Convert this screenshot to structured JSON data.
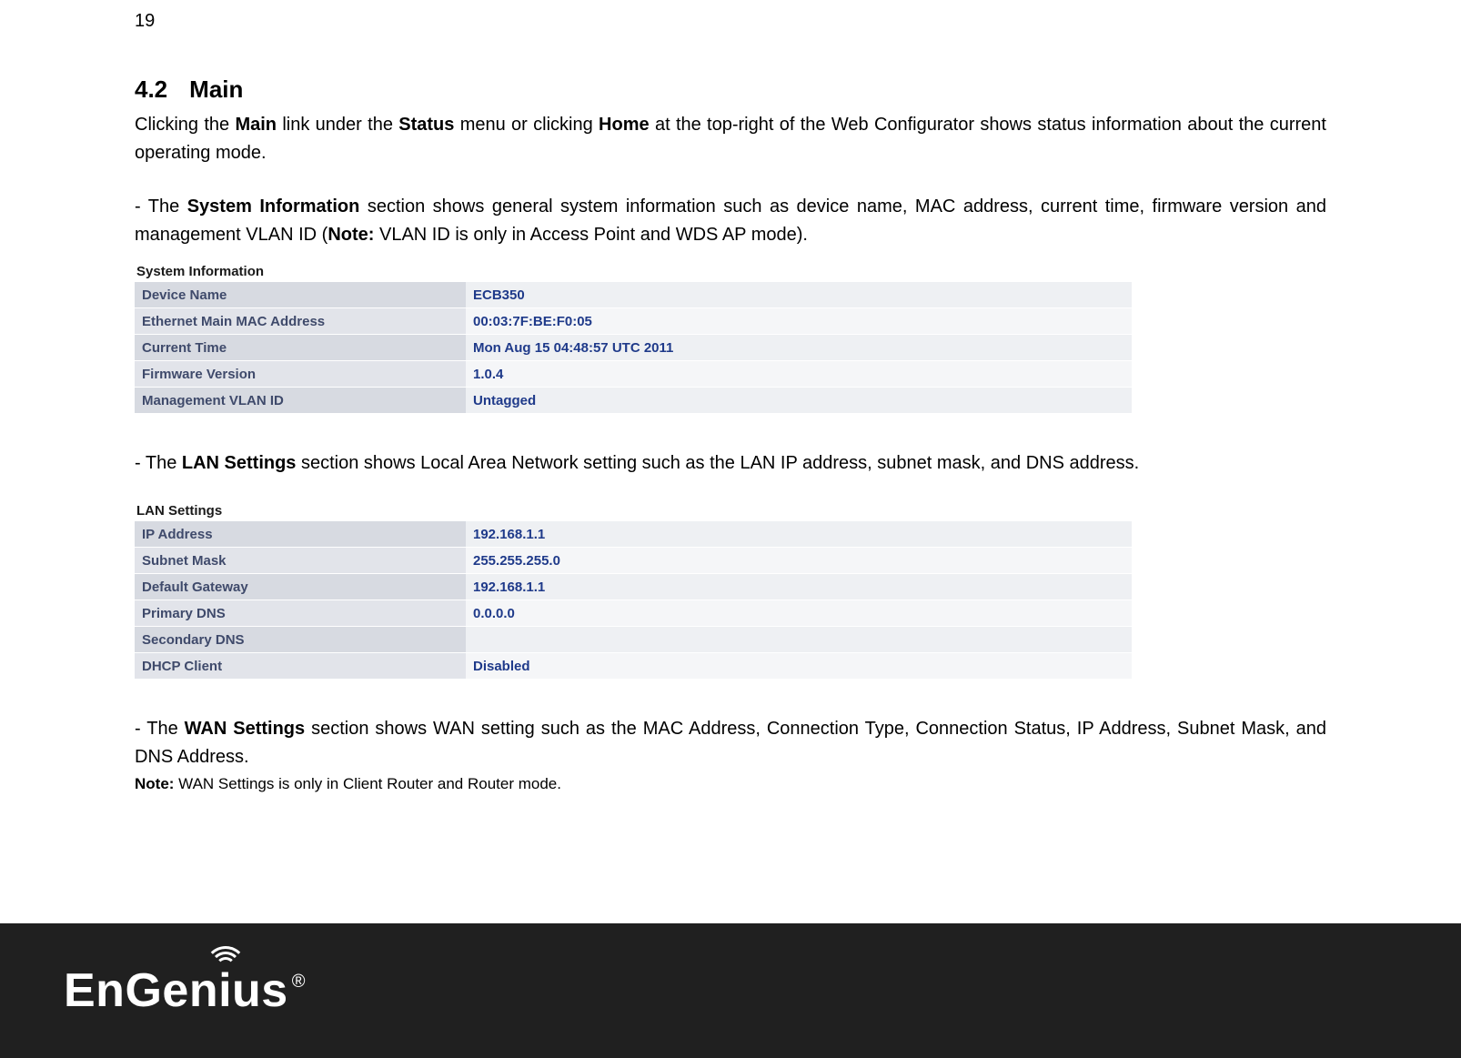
{
  "page_number": "19",
  "heading": {
    "number": "4.2",
    "title": "Main"
  },
  "intro": {
    "pre1": "Clicking the ",
    "b1": "Main",
    "mid1": " link under the ",
    "b2": "Status",
    "mid2": " menu or clicking ",
    "b3": "Home",
    "post": " at the top-right of the Web Configurator shows status information about the current operating mode."
  },
  "sysinfo_bullet": {
    "pre": "- The ",
    "b1": "System Information",
    "mid1": " section shows general system information such as device name, MAC address, current time, firmware version and management VLAN ID (",
    "b2": "Note:",
    "post": " VLAN ID is only in Access Point and WDS AP mode)."
  },
  "sysinfo_table": {
    "caption": "System Information",
    "rows": [
      {
        "label": "Device Name",
        "value": "ECB350"
      },
      {
        "label": "Ethernet Main MAC Address",
        "value": "00:03:7F:BE:F0:05"
      },
      {
        "label": "Current Time",
        "value": "Mon Aug 15 04:48:57 UTC 2011"
      },
      {
        "label": "Firmware Version",
        "value": "1.0.4"
      },
      {
        "label": "Management VLAN ID",
        "value": "Untagged"
      }
    ]
  },
  "lan_bullet": {
    "pre": "- The ",
    "b1": "LAN Settings",
    "post": " section shows Local Area Network setting such as the LAN IP address, subnet mask, and DNS address."
  },
  "lan_table": {
    "caption": "LAN Settings",
    "rows": [
      {
        "label": "IP Address",
        "value": "192.168.1.1"
      },
      {
        "label": "Subnet Mask",
        "value": "255.255.255.0"
      },
      {
        "label": "Default Gateway",
        "value": "192.168.1.1"
      },
      {
        "label": "Primary DNS",
        "value": "0.0.0.0"
      },
      {
        "label": "Secondary DNS",
        "value": ""
      },
      {
        "label": "DHCP Client",
        "value": "Disabled"
      }
    ]
  },
  "wan_bullet": {
    "pre": "- The ",
    "b1": "WAN Settings",
    "post": " section shows WAN setting such as the MAC Address, Connection Type, Connection Status, IP Address, Subnet Mask, and DNS Address."
  },
  "wan_note": {
    "b": "Note:",
    "text": " WAN Settings is only in Client Router and Router mode."
  },
  "logo": {
    "pre": "EnGen",
    "i": "i",
    "post": "us",
    "reg": "®"
  }
}
